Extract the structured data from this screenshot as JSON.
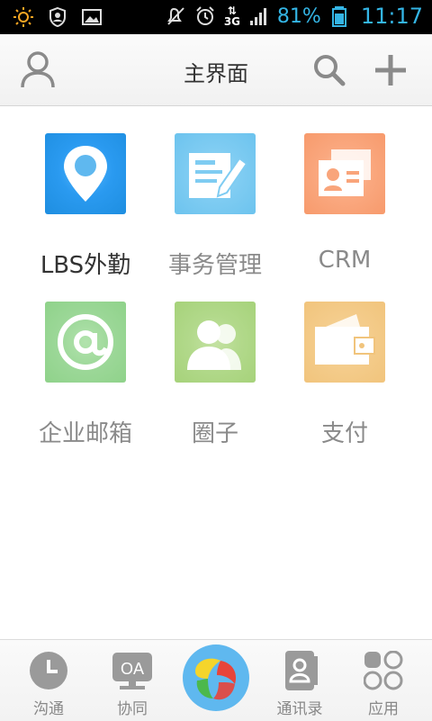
{
  "status_bar": {
    "battery_percent": "81%",
    "time": "11:17",
    "network_label": "3G",
    "accent_color": "#34b5e5"
  },
  "header": {
    "title": "主界面",
    "left_icon": "user-icon",
    "right_icons": [
      "search-icon",
      "add-icon"
    ]
  },
  "apps": [
    {
      "label": "LBS外勤",
      "icon": "location-pin-icon",
      "color": "#1e8ee0",
      "active": true
    },
    {
      "label": "事务管理",
      "icon": "document-edit-icon",
      "color": "#6cc3ee"
    },
    {
      "label": "CRM",
      "icon": "contact-card-icon",
      "color": "#f79a6c"
    },
    {
      "label": "企业邮箱",
      "icon": "at-sign-icon",
      "color": "#8fd28a"
    },
    {
      "label": "圈子",
      "icon": "people-group-icon",
      "color": "#a6d27a"
    },
    {
      "label": "支付",
      "icon": "wallet-icon",
      "color": "#f1c47c"
    }
  ],
  "tab_bar": {
    "tabs": [
      {
        "label": "沟通",
        "icon": "clock-icon"
      },
      {
        "label": "协同",
        "icon": "oa-icon",
        "icon_text": "OA"
      },
      {
        "label": "",
        "icon": "app-logo-icon"
      },
      {
        "label": "通讯录",
        "icon": "contacts-book-icon"
      },
      {
        "label": "应用",
        "icon": "apps-grid-icon"
      }
    ]
  }
}
